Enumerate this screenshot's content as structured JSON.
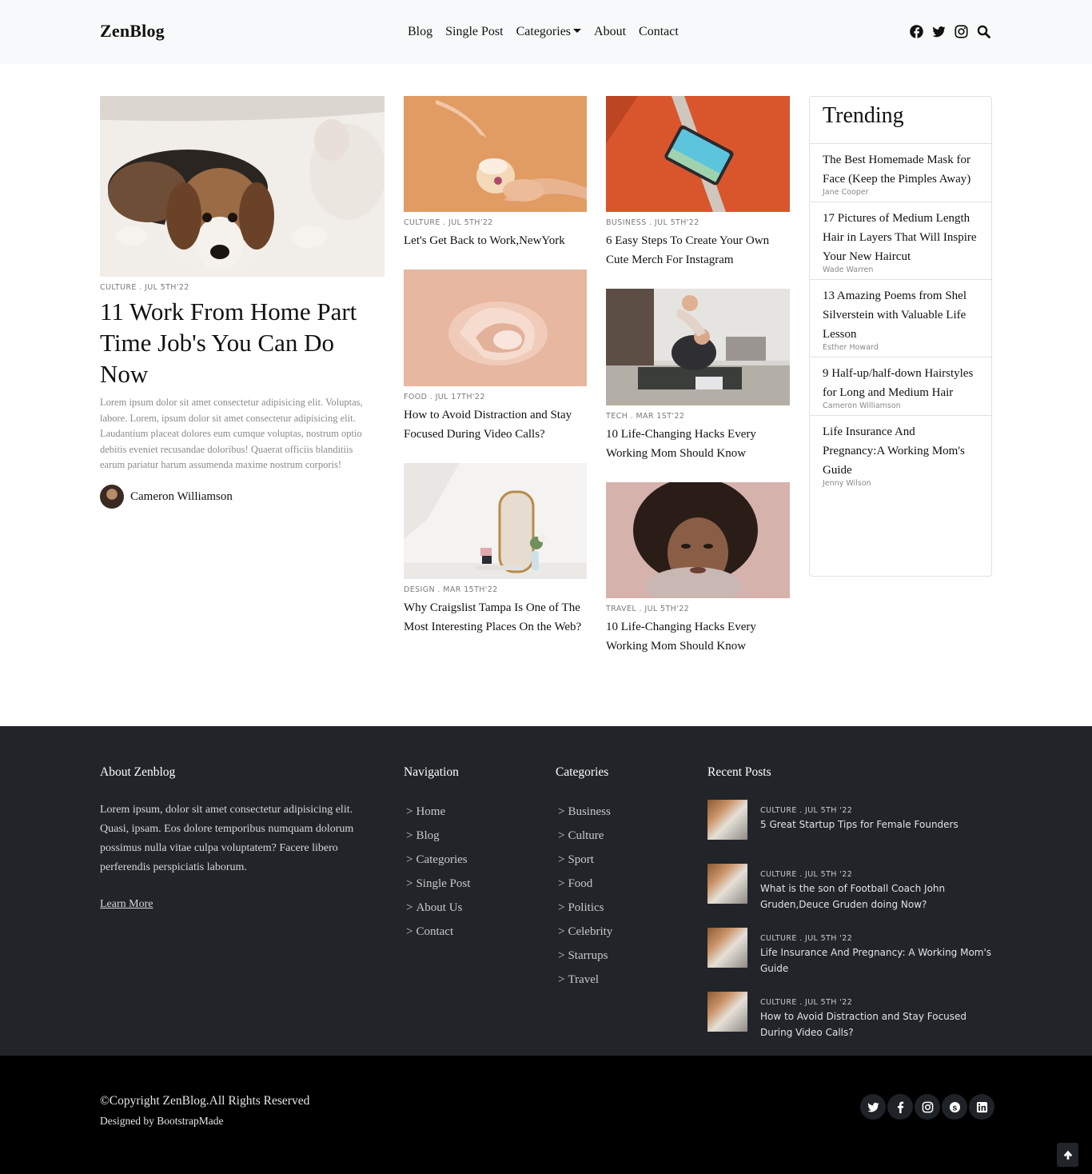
{
  "header": {
    "logo": "ZenBlog",
    "nav": [
      "Blog",
      "Single Post",
      "Categories",
      "About",
      "Contact"
    ],
    "icons": [
      "facebook-icon",
      "twitter-icon",
      "instagram-icon",
      "search-icon"
    ]
  },
  "hero": {
    "meta": "CULTURE . JUL 5TH'22",
    "title": "11 Work From Home Part Time Job's You Can Do Now",
    "excerpt": "Lorem ipsum dolor sit amet consectetur adipisicing elit. Voluptas, labore. Lorem, ipsum dolor sit amet consectetur adipisicing elit. Laudantium placeat dolores eum cumque voluptas, nostrum optio debitis eveniet recusandae doloribus! Quaerat officiis blanditiis earum pariatur harum assumenda maxime nostrum corporis!",
    "author": "Cameron Williamson"
  },
  "col2": [
    {
      "meta": "CULTURE . JUL 5TH'22",
      "title": "Let's Get Back to Work,NewYork"
    },
    {
      "meta": "FOOD . JUL 17TH'22",
      "title": "How to Avoid Distraction and Stay Focused During Video Calls?"
    },
    {
      "meta": "DESIGN . MAR 15TH'22",
      "title": "Why Craigslist Tampa Is One of The Most Interesting Places On the Web?"
    }
  ],
  "col3": [
    {
      "meta": "BUSINESS . JUL 5TH'22",
      "title": "6 Easy Steps To Create Your Own Cute Merch For Instagram"
    },
    {
      "meta": "TECH . MAR 1ST'22",
      "title": "10 Life-Changing Hacks Every Working Mom Should Know"
    },
    {
      "meta": "TRAVEL . JUL 5TH'22",
      "title": "10 Life-Changing Hacks Every Working Mom Should Know"
    }
  ],
  "trending": {
    "heading": "Trending",
    "items": [
      {
        "title": "The Best Homemade Mask for Face (Keep the Pimples Away)",
        "author": "Jane Cooper"
      },
      {
        "title": "17 Pictures of Medium Length Hair in Layers That Will Inspire Your New Haircut",
        "author": "Wade Warren"
      },
      {
        "title": "13 Amazing Poems from Shel Silverstein with Valuable Life Lesson",
        "author": "Esther Howard"
      },
      {
        "title": "9 Half-up/half-down Hairstyles for Long and Medium Hair",
        "author": "Cameron Williamson"
      },
      {
        "title": "Life Insurance And Pregnancy:A Working Mom's Guide",
        "author": "Jenny Wilson"
      }
    ]
  },
  "footer": {
    "about_heading": "About Zenblog",
    "about_text": "Lorem ipsum, dolor sit amet consectetur adipisicing elit. Quasi, ipsam. Eos dolore temporibus numquam dolorum possimus nulla vitae culpa voluptatem? Facere libero perferendis perspiciatis laborum.",
    "learn_more": "Learn More",
    "nav_heading": "Navigation",
    "nav": [
      "Home",
      "Blog",
      "Categories",
      "Single Post",
      "About Us",
      "Contact"
    ],
    "cat_heading": "Categories",
    "categories": [
      "Business",
      "Culture",
      "Sport",
      "Food",
      "Politics",
      "Celebrity",
      "Starrups",
      "Travel"
    ],
    "recent_heading": "Recent Posts",
    "recent": [
      {
        "meta": "CULTURE . JUL 5TH '22",
        "title": "5 Great Startup Tips for Female Founders"
      },
      {
        "meta": "CULTURE . JUL 5TH '22",
        "title": "What is the son of Football Coach John Gruden,Deuce Gruden doing Now?"
      },
      {
        "meta": "CULTURE . JUL 5TH '22",
        "title": "Life Insurance And Pregnancy: A Working Mom's Guide"
      },
      {
        "meta": "CULTURE . JUL 5TH '22",
        "title": "How to Avoid Distraction and Stay Focused During Video Calls?"
      }
    ],
    "copyright": "©Copyright ZenBlog.All Rights Reserved",
    "designed_by": "Designed by BootstrapMade",
    "socials": [
      "twitter-icon",
      "facebook-icon",
      "instagram-icon",
      "skype-icon",
      "linkedin-icon"
    ]
  }
}
